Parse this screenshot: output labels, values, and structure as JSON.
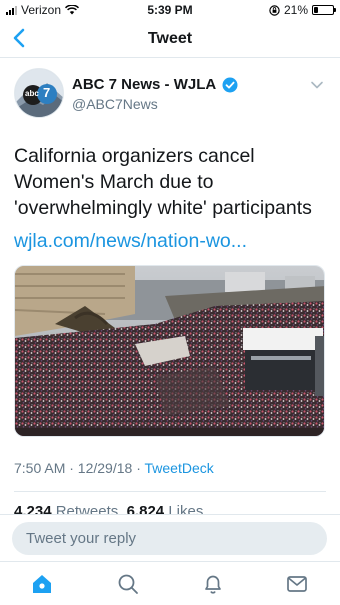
{
  "status_bar": {
    "carrier": "Verizon",
    "time": "5:39 PM",
    "battery_percent": "21%",
    "battery_level": 0.21
  },
  "nav": {
    "title": "Tweet"
  },
  "author": {
    "name": "ABC 7 News - WJLA",
    "handle": "@ABC7News",
    "verified": true,
    "avatar_text": "abc",
    "avatar_number": "7"
  },
  "tweet": {
    "text_lines": [
      "California organizers cancel",
      "Women's March due to",
      "'overwhelmingly white' participants"
    ],
    "link": "wjla.com/news/nation-wo...",
    "timestamp": "7:50 AM · 12/29/18 · ",
    "source": "TweetDeck"
  },
  "stats": {
    "retweets_count": "4,234",
    "retweets_label": "Retweets",
    "likes_count": "6,824",
    "likes_label": "Likes"
  },
  "reply": {
    "placeholder": "Tweet your reply"
  },
  "tab_bar": {
    "items": [
      "home",
      "search",
      "notifications",
      "messages"
    ],
    "active": "home"
  },
  "colors": {
    "accent": "#1da1f2",
    "link": "#1b95e0",
    "muted": "#657786",
    "divider": "#e1e8ed"
  }
}
